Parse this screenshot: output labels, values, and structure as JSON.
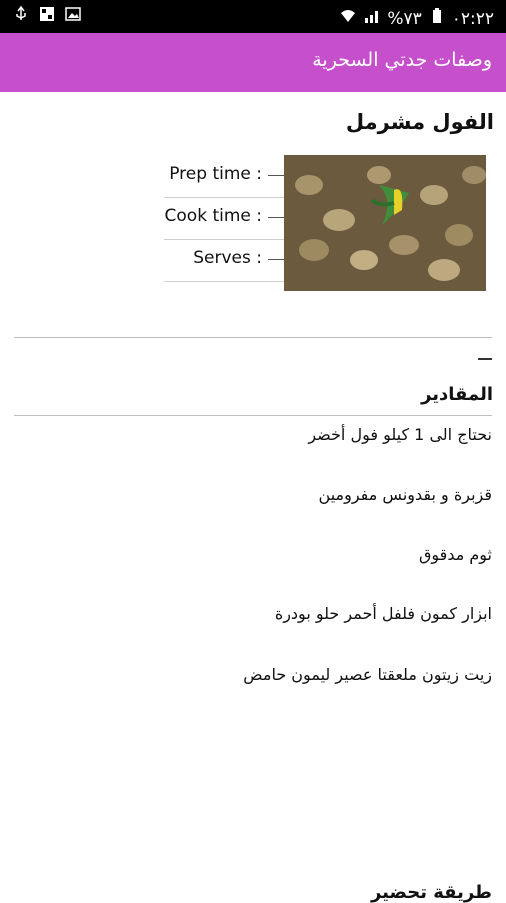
{
  "status_bar": {
    "time": "٠٢:٢٢",
    "battery": "%٧٣"
  },
  "app_bar": {
    "title": "وصفات جدتي السحرية"
  },
  "recipe": {
    "title": "الفول مشرمل",
    "meta": {
      "prep_label": "Prep time :",
      "cook_label": "Cook time :",
      "serves_label": "Serves :"
    },
    "section_title": "المقادير",
    "ingredients": [
      "نحتاج الى 1 كيلو فول أخضر",
      "قزبرة و بقدونس مفرومين",
      "ثوم مدقوق",
      "ابزار كمون فلفل أحمر حلو بودرة",
      "زيت زيتون ملعقتا عصير ليمون حامض"
    ],
    "method_title": "طريقة تحضير"
  },
  "colors": {
    "app_bar": "#c64fcc",
    "status_bar": "#000000"
  }
}
